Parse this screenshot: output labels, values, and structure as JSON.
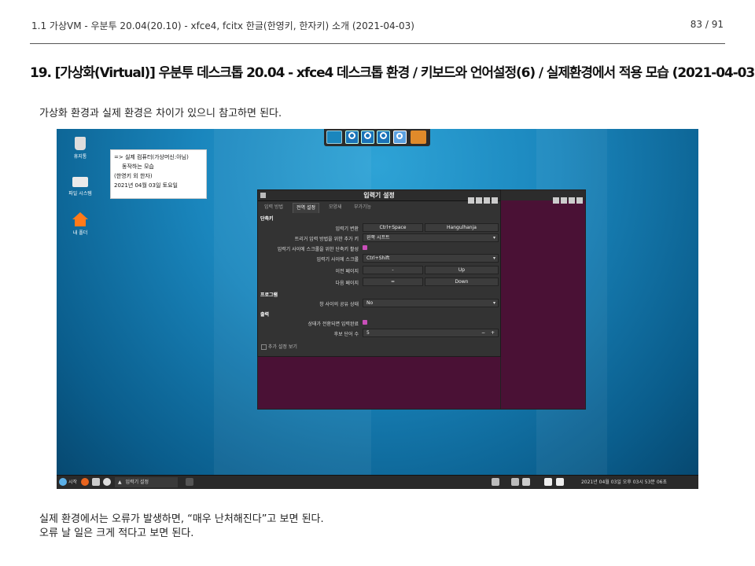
{
  "header": {
    "title": "1.1 가상VM - 우분투 20.04(20.10) - xfce4, fcitx 한글(한영키, 한자키) 소개 (2021-04-03)",
    "page_number": "83 / 91"
  },
  "section_title": "19. [가상화(Virtual)] 우분투 데스크톱 20.04 - xfce4 데스크톱 환경 / 키보드와 언어설정(6) / 실제환경에서 적용 모습 (2021-04-03)",
  "intro_text": "가상화 환경과 실제 환경은 차이가 있으니 참고하면 된다.",
  "outro": {
    "line1": "실제 환경에서는 오류가 발생하면, “매우 난처해진다”고 보면 된다.",
    "line2": "오류 날 일은 크게 적다고 보면 된다."
  },
  "screenshot": {
    "desktop_icons": [
      {
        "label": "휴지통",
        "icon": "trash-icon"
      },
      {
        "label": "파일 시스템",
        "icon": "drive-icon"
      },
      {
        "label": "내 폴더",
        "icon": "home-folder-icon"
      }
    ],
    "note": {
      "line1": "=> 실제 컴퓨터(가상머신:아님)",
      "line2": "동작하는 모습",
      "line3": "(한영키 외 한자)",
      "line4": "2021년 04월 03일 토요일"
    },
    "dialog": {
      "title": "입력기 설정",
      "tabs": [
        "입력 방법",
        "전역 설정",
        "모양새",
        "부가기능"
      ],
      "active_tab": "전역 설정",
      "section_hotkey": "단축키",
      "row_toggle_label": "입력기 변환",
      "row_toggle_val1": "Ctrl+Space",
      "row_toggle_val2": "Hangulhanja",
      "row_trigger_label": "트리거 입력 방법을 위한 추가 키",
      "row_trigger_val": "왼쪽 시프트",
      "row_enable_label": "입력기 사이에 스크롤을 위한 단축키 활성",
      "row_scroll_label": "입력기 사이에 스크롤",
      "row_scroll_val": "Ctrl+Shift",
      "row_prev_label": "이전 페이지",
      "row_prev_val1": "-",
      "row_prev_val2": "Up",
      "row_next_label": "다음 페이지",
      "row_next_val1": "=",
      "row_next_val2": "Down",
      "section_program": "프로그램",
      "row_share_label": "창 사이의 공유 상태",
      "row_share_val": "No",
      "section_output": "출력",
      "row_commit_label": "상태가 전환되면 입력완료",
      "row_cand_label": "후보 단어 수",
      "row_cand_val": "5",
      "minus": "−",
      "plus": "+",
      "advanced": "추가 설정 보기"
    },
    "taskbar": {
      "start_label": "시작",
      "window_label": "입력기 설정",
      "clock": "2021년 04월 03일 오후 03시 53분 06초"
    }
  }
}
